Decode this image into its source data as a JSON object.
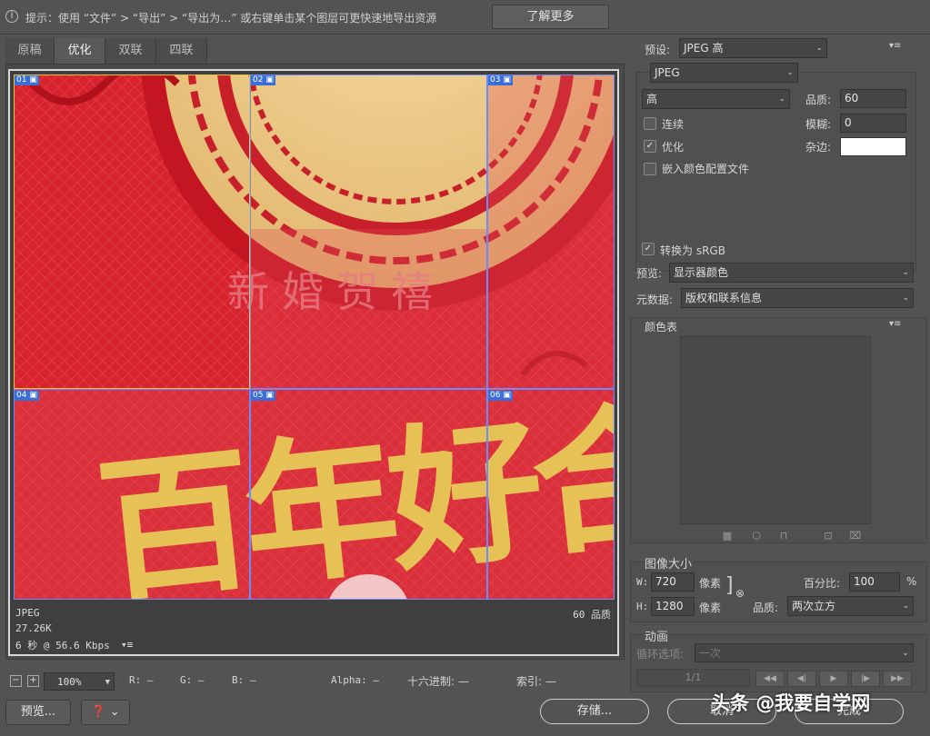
{
  "tip": {
    "icon": "info-icon",
    "text": "提示：使用 “文件” > “导出” > “导出为…” 或右键单击某个图层可更快速地导出资源",
    "learn_more": "了解更多"
  },
  "tabs": [
    {
      "label": "原稿",
      "active": false
    },
    {
      "label": "优化",
      "active": true
    },
    {
      "label": "双联",
      "active": false
    },
    {
      "label": "四联",
      "active": false
    }
  ],
  "preview": {
    "slices": [
      "01",
      "02",
      "03",
      "04",
      "05",
      "06"
    ],
    "image_text": {
      "big": "百年好合",
      "small": "新婚贺禧"
    },
    "status": {
      "format": "JPEG",
      "size": "27.26K",
      "time": "6 秒 @ 56.6 Kbps",
      "quality": "60 品质"
    }
  },
  "bottombar": {
    "zoom": "100%",
    "r": "R: —",
    "g": "G: —",
    "b": "B: —",
    "alpha": "Alpha: —",
    "hex": "十六进制: —",
    "index": "索引: —"
  },
  "settings": {
    "preset_label": "预设:",
    "preset_value": "JPEG 高",
    "format": "JPEG",
    "quality_preset": "高",
    "quality_label": "品质:",
    "quality_value": "60",
    "progressive_label": "连续",
    "progressive_checked": false,
    "blur_label": "模糊:",
    "blur_value": "0",
    "optimized_label": "优化",
    "optimized_checked": true,
    "matte_label": "杂边:",
    "matte_color": "#ffffff",
    "embed_label": "嵌入颜色配置文件",
    "embed_checked": false,
    "srgb_label": "转换为 sRGB",
    "srgb_checked": true,
    "preview_label": "预览:",
    "preview_value": "显示器颜色",
    "metadata_label": "元数据:",
    "metadata_value": "版权和联系信息"
  },
  "color_table": {
    "title": "颜色表"
  },
  "image_size": {
    "title": "图像大小",
    "w_label": "W:",
    "w_value": "720",
    "h_label": "H:",
    "h_value": "1280",
    "unit": "像素",
    "percent_label": "百分比:",
    "percent_value": "100",
    "percent_unit": "%",
    "quality_label": "品质:",
    "quality_value": "两次立方"
  },
  "animation": {
    "title": "动画",
    "loop_label": "循环选项:",
    "loop_value": "一次",
    "frame": "1/1"
  },
  "footer": {
    "preview_btn": "预览...",
    "save_btn": "存储...",
    "cancel_btn": "取消",
    "done_btn": "完成"
  },
  "watermark": "头条 @我要自学网",
  "colors": {
    "bg": "#535353",
    "image_red": "#d8232e",
    "gold": "#e8c25a",
    "slice_blue": "#3a6fd8"
  }
}
